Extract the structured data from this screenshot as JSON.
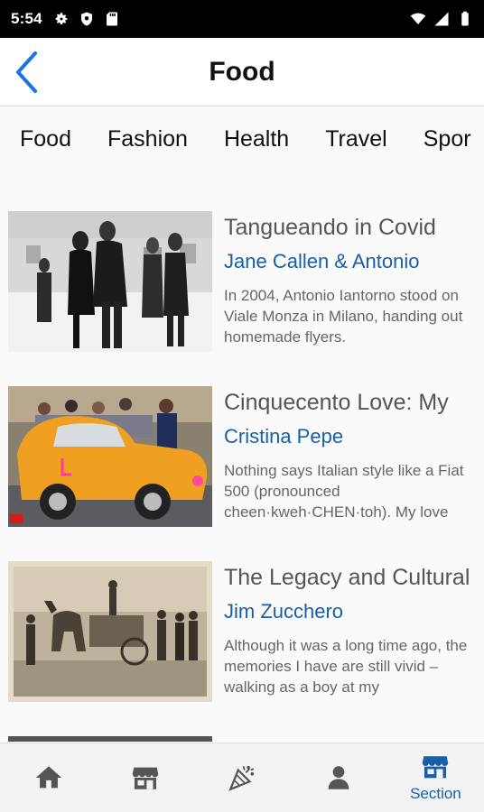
{
  "status_bar": {
    "time": "5:54",
    "icons_left": [
      "gear-icon",
      "shield-icon",
      "sd-card-icon"
    ],
    "icons_right": [
      "wifi-icon",
      "signal-icon",
      "battery-icon"
    ]
  },
  "app_bar": {
    "title": "Food",
    "back_icon": "chevron-left-icon",
    "accent_color": "#1a73e8"
  },
  "tabs": [
    {
      "label": "Food"
    },
    {
      "label": "Fashion"
    },
    {
      "label": "Health"
    },
    {
      "label": "Travel"
    },
    {
      "label": "Spor"
    }
  ],
  "articles": [
    {
      "title": "Tangueando in Covid",
      "author": "Jane Callen & Antonio",
      "excerpt": "In 2004, Antonio Iantorno stood on Viale Monza in Milano, handing out homemade flyers."
    },
    {
      "title": "Cinquecento Love: My",
      "author": "Cristina Pepe",
      "excerpt": "Nothing says Italian style like a Fiat 500 (pronounced cheen·kweh·CHEN·toh). My love"
    },
    {
      "title": "The Legacy and Cultural",
      "author": "Jim Zucchero",
      "excerpt": "Although it was a long time ago, the memories I have are still vivid – walking as a boy at my"
    }
  ],
  "bottom_nav": [
    {
      "icon": "home-icon",
      "label": ""
    },
    {
      "icon": "storefront-icon",
      "label": ""
    },
    {
      "icon": "party-popper-icon",
      "label": ""
    },
    {
      "icon": "person-icon",
      "label": ""
    },
    {
      "icon": "section-storefront-icon",
      "label": "Section",
      "active": true
    }
  ],
  "colors": {
    "author": "#1a5fa6",
    "active_nav": "#1a5fa6",
    "inactive_nav": "#555555"
  }
}
